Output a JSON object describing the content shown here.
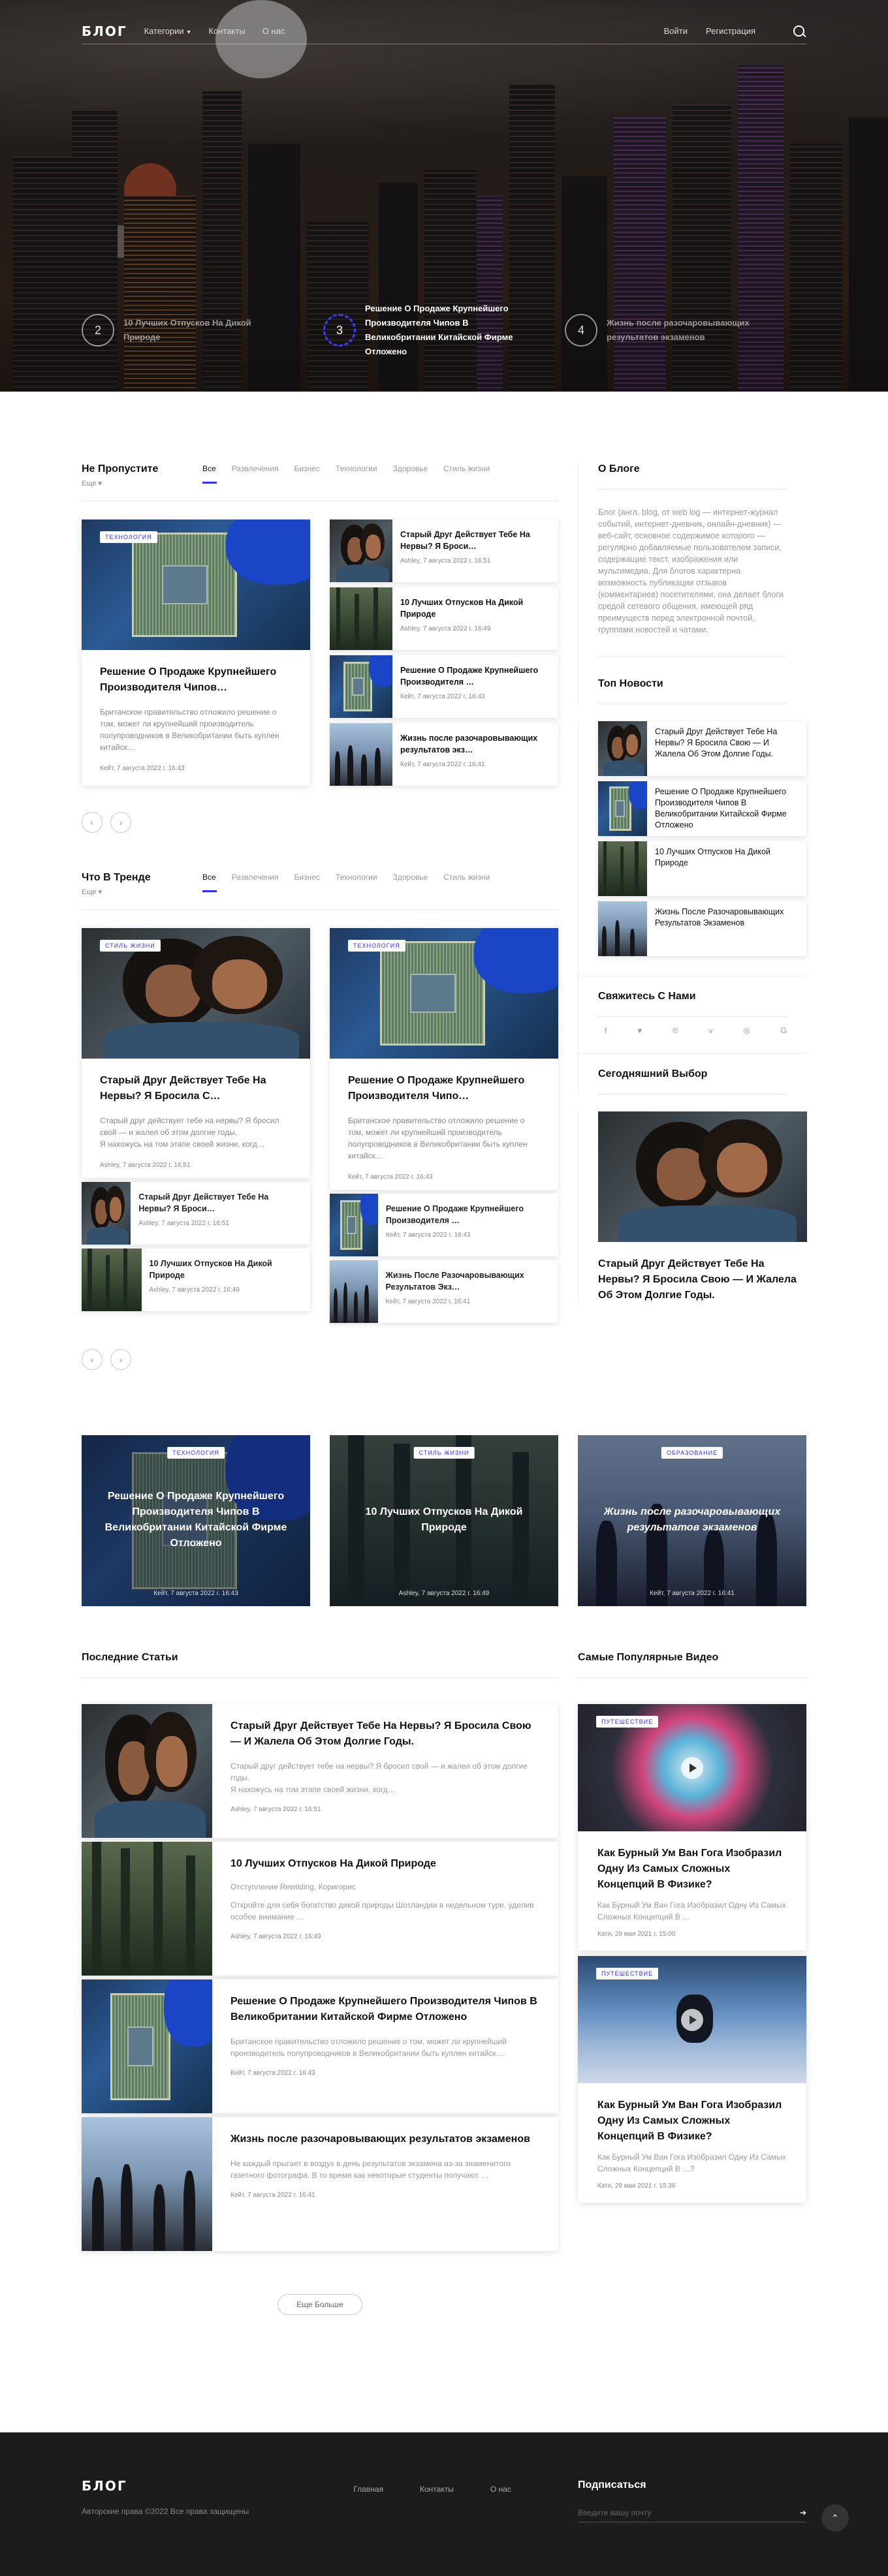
{
  "nav": {
    "logo": "БЛОГ",
    "categories": "Категории",
    "contacts": "Контакты",
    "about": "О нас",
    "login": "Войти",
    "register": "Регистрация"
  },
  "hero": {
    "slides": [
      {
        "num": "2",
        "title": "10 Лучших Отпусков На Дикой Природе"
      },
      {
        "num": "3",
        "title": "Решение О Продаже Крупнейшего Производителя Чипов В Великобритании Китайской Фирме Отложено"
      },
      {
        "num": "4",
        "title": "Жизнь после разочаровывающих результатов экзаменов"
      }
    ]
  },
  "tabs": [
    "Все",
    "Развлечения",
    "Бизнес",
    "Технологии",
    "Здоровье",
    "Стиль жизни"
  ],
  "more_label": "Еще",
  "dont_miss": {
    "title": "Не Пропустите",
    "big": {
      "badge": "ТЕХНОЛОГИЯ",
      "title": "Решение О Продаже Крупнейшего Производителя Чипов…",
      "text": "Британское правительство отложило решение о том, может ли крупнейший производитель полупроводников в Великобритании быть куплен китайск…",
      "meta": "Кейт, 7 августа 2022 г. 16:43"
    },
    "list": [
      {
        "title": "Старый Друг Действует Тебе На Нервы? Я Броси…",
        "meta": "Ashley, 7 августа 2022 г. 16:51"
      },
      {
        "title": "10 Лучших Отпусков На Дикой Природе",
        "meta": "Ashley, 7 августа 2022 г. 16:49"
      },
      {
        "title": "Решение О Продаже Крупнейшего Производителя …",
        "meta": "Кейт, 7 августа 2022 г. 16:43"
      },
      {
        "title": "Жизнь после разочаровывающих результатов экз…",
        "meta": "Кейт, 7 августа 2022 г. 16:41"
      }
    ]
  },
  "trending": {
    "title": "Что В Тренде",
    "big": [
      {
        "badge": "СТИЛЬ ЖИЗНИ",
        "title": "Старый Друг Действует Тебе На Нервы? Я Бросила С…",
        "text": "Старый друг действует тебе на нервы? Я бросил свой — и жалел об этом долгие годы.\nЯ нахожусь на том этапе своей жизни, когд…",
        "meta": "Ashley, 7 августа 2022 г. 16:51"
      },
      {
        "badge": "ТЕХНОЛОГИЯ",
        "title": "Решение О Продаже Крупнейшего Производителя Чипо…",
        "text": "Британское правительство отложило решение о том, может ли крупнейший производитель полупроводников в Великобритании быть куплен китайск…",
        "meta": "Кейт, 7 августа 2022 г. 16:43"
      }
    ],
    "list": [
      {
        "title": "Старый Друг Действует Тебе На Нервы? Я Броси…",
        "meta": "Ashley, 7 августа 2022 г. 16:51"
      },
      {
        "title": "Решение О Продаже Крупнейшего Производителя …",
        "meta": "Кейт, 7 августа 2022 г. 16:43"
      },
      {
        "title": "10 Лучших Отпусков На Дикой Природе",
        "meta": "Ashley, 7 августа 2022 г. 16:49"
      },
      {
        "title": "Жизнь После Разочаровывающих Результатов Экз…",
        "meta": "Кейт, 7 августа 2022 г. 16:41"
      }
    ]
  },
  "sidebar": {
    "about_title": "О Блоге",
    "about_text": "Блог (англ. blog, от web log — интернет-журнал событий, интернет-дневник, онлайн-дневник) — веб-сайт, основное содержимое которого — регулярно добавляемые пользователем записи, содержащие текст, изображения или мультимедиа. Для блогов характерна возможность публикации отзывов (комментариев) посетителями, она делает блоги средой сетевого общения, имеющей ряд преимуществ перед электронной почтой, группами новостей и чатами.",
    "top_title": "Топ Новости",
    "top": [
      "Старый Друг Действует Тебе На Нервы? Я Бросила Свою — И Жалела Об Этом Долгие Годы.",
      "Решение О Продаже Крупнейшего Производителя Чипов В Великобритании Китайской Фирме Отложено",
      "10 Лучших Отпусков На Дикой Природе",
      "Жизнь После Разочаровывающих Результатов Экзаменов"
    ],
    "contact_title": "Свяжитесь С Нами",
    "social": [
      "f",
      "♥",
      "℗",
      "v",
      "◎",
      "G"
    ],
    "pick_title": "Сегодняшний Выбор",
    "pick": "Старый Друг Действует Тебе На Нервы? Я Бросила Свою — И Жалела Об Этом Долгие Годы."
  },
  "band": [
    {
      "badge": "ТЕХНОЛОГИЯ",
      "title": "Решение О Продаже Крупнейшего Производителя Чипов В Великобритании Китайской Фирме Отложено",
      "meta": "Кейт, 7 августа 2022 г. 16:43"
    },
    {
      "badge": "СТИЛЬ ЖИЗНИ",
      "title": "10 Лучших Отпусков На Дикой Природе",
      "meta": "Ashley, 7 августа 2022 г. 16:49"
    },
    {
      "badge": "ОБРАЗОВАНИЕ",
      "title": "Жизнь после разочаровывающих результатов экзаменов",
      "meta": "Кейт, 7 августа 2022 г. 16:41"
    }
  ],
  "latest": {
    "title": "Последние Статьи",
    "items": [
      {
        "title": "Старый Друг Действует Тебе На Нервы? Я Бросила Свою — И Жалела Об Этом Долгие Годы.",
        "sub": "",
        "text": "Старый друг действует тебе на нервы? Я бросил свой — и жалел об этом долгие годы.\nЯ нахожусь на том этапе своей жизни, когд…",
        "meta": "Ashley, 7 августа 2022 г. 16:51"
      },
      {
        "title": "10 Лучших Отпусков На Дикой Природе",
        "sub": "Отступление Rewilding, Коригорис",
        "text": "Откройте для себя богатство дикой природы Шотландии в недельном туре, уделив особое внимание …",
        "meta": "Ashley, 7 августа 2022 г. 16:49"
      },
      {
        "title": "Решение О Продаже Крупнейшего Производителя Чипов В Великобритании Китайской Фирме Отложено",
        "sub": "",
        "text": "Британское правительство отложило решение о том, может ли крупнейший производитель полупроводников в Великобритании быть куплен китайск…",
        "meta": "Кейт, 7 августа 2022 г. 16:43"
      },
      {
        "title": "Жизнь после разочаровывающих результатов экзаменов",
        "sub": "",
        "text": "Не каждый прыгает в воздух в день результатов экзамена из-за знаменитого газетного фотографа. В то время как некоторые студенты получают …",
        "meta": "Кейт, 7 августа 2022 г. 16:41"
      }
    ],
    "more": "Еще Больше"
  },
  "videos": {
    "title": "Самые Популярные Видео",
    "items": [
      {
        "badge": "ПУТЕШЕСТВИЕ",
        "title": "Как Бурный Ум Ван Гога Изобразил Одну Из Самых Сложных Концепций В Физике?",
        "text": "Как Бурный Ум Ван Гога Изобразил Одну Из Самых Сложных Концепций В …",
        "meta": "Катя, 29 мая 2021 г. 15:00"
      },
      {
        "badge": "ПУТЕШЕСТВИЕ",
        "title": "Как Бурный Ум Ван Гога Изобразил Одну Из Самых Сложных Концепций В Физике?",
        "text": "Как Бурный Ум Ван Гога Изобразил Одну Из Самых Сложных Концепций В …?",
        "meta": "Катя, 29 мая 2021 г. 15:36"
      }
    ]
  },
  "footer": {
    "logo": "БЛОГ",
    "copy": "Авторские права ©2022 Все права защищены",
    "links": [
      "Главная",
      "Контакты",
      "О нас"
    ],
    "subscribe": "Подписаться",
    "placeholder": "Введите вашу почту"
  },
  "colors": {
    "accent": "#2f2ff5",
    "footer_bg": "#1c1c1c"
  }
}
